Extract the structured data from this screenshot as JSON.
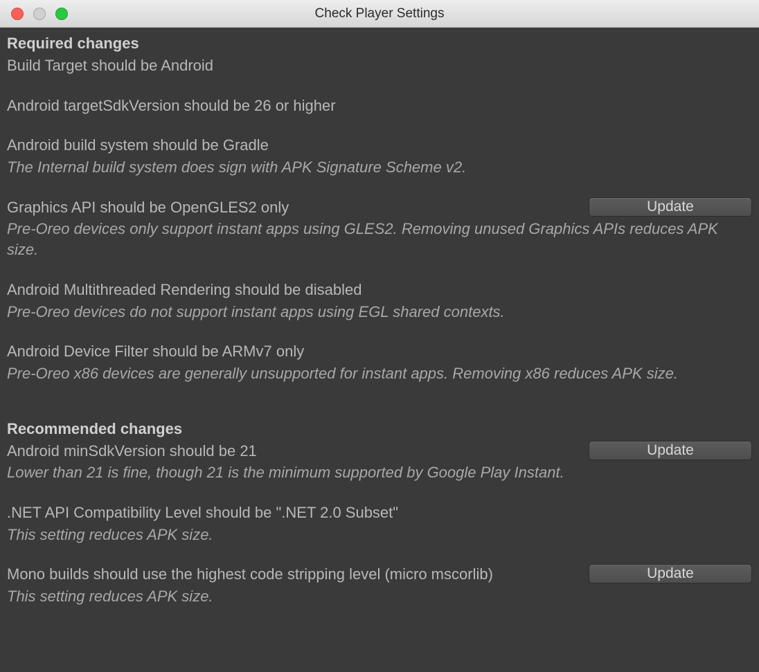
{
  "window": {
    "title": "Check Player Settings"
  },
  "buttons": {
    "update": "Update"
  },
  "sections": {
    "required": {
      "heading": "Required changes",
      "items": [
        {
          "title": "Build Target should be Android",
          "desc": "",
          "has_button": false
        },
        {
          "title": "Android targetSdkVersion should be 26 or higher",
          "desc": "",
          "has_button": false
        },
        {
          "title": "Android build system should be Gradle",
          "desc": "The Internal build system does sign with APK Signature Scheme v2.",
          "has_button": false
        },
        {
          "title": "Graphics API should be OpenGLES2 only",
          "desc": "Pre-Oreo devices only support instant apps using GLES2. Removing unused Graphics APIs reduces APK size.",
          "has_button": true
        },
        {
          "title": "Android Multithreaded Rendering should be disabled",
          "desc": "Pre-Oreo devices do not support instant apps using EGL shared contexts.",
          "has_button": false
        },
        {
          "title": "Android Device Filter should be ARMv7 only",
          "desc": "Pre-Oreo x86 devices are generally unsupported for instant apps. Removing x86 reduces APK size.",
          "has_button": false
        }
      ]
    },
    "recommended": {
      "heading": "Recommended changes",
      "items": [
        {
          "title": "Android minSdkVersion should be 21",
          "desc": "Lower than 21 is fine, though 21 is the minimum supported by Google Play Instant.",
          "has_button": true
        },
        {
          "title": ".NET API Compatibility Level should be \".NET 2.0 Subset\"",
          "desc": "This setting reduces APK size.",
          "has_button": false
        },
        {
          "title": "Mono builds should use the highest code stripping level (micro mscorlib)",
          "desc": "This setting reduces APK size.",
          "has_button": true
        }
      ]
    }
  }
}
